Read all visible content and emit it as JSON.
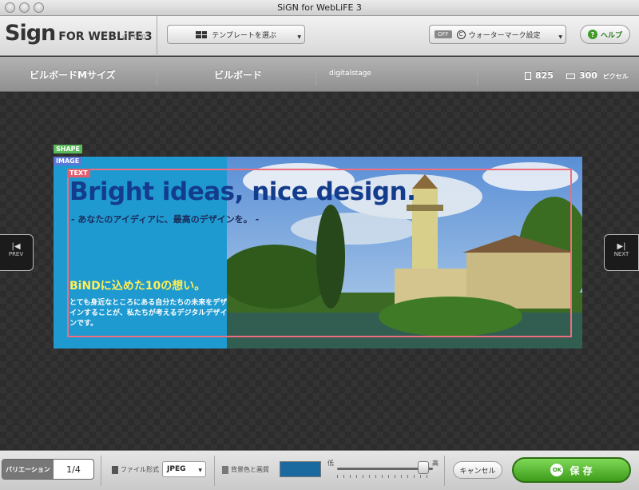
{
  "window": {
    "title": "SiGN for WebLiFE 3"
  },
  "toolbar": {
    "logo_sign": "Sign",
    "logo_rest": "FOR WEBLiFE",
    "logo_num": "3",
    "version": "v.3.000",
    "template_button": "テンプレートを選ぶ",
    "watermark_state": "OFF",
    "watermark_label": "ウォーターマーク設定",
    "help_label": "ヘルプ"
  },
  "info": {
    "size_name": "ビルボードMサイズ",
    "category": "ビルボード",
    "author": "digitalstage",
    "height": "825",
    "width": "300",
    "unit": "ピクセル"
  },
  "nav": {
    "prev": "PREV",
    "next": "NEXT"
  },
  "layers": {
    "shape": "SHAPE",
    "image": "IMAGE",
    "text": "TEXT"
  },
  "banner": {
    "headline": "Bright ideas, nice design.",
    "subline": "- あなたのアイディアに、最高のデザインを。 -",
    "bind_title": "BiNDに込めた10の想い。",
    "bind_body": "とても身近なところにある自分たちの未来をデザインすることが、私たちが考えるデジタルデザインです。"
  },
  "bottom": {
    "variation_label": "バリエーション",
    "variation_count": "1/4",
    "file_format_label": "ファイル形式",
    "file_format_value": "JPEG",
    "bg_quality_label": "背景色と画質",
    "quality_low": "低",
    "quality_high": "高",
    "quality_level": 0.9,
    "cancel_label": "キャンセル",
    "ok_badge": "OK",
    "save_label": "保 存"
  },
  "colors": {
    "banner_blue": "#1e9ad1",
    "headline": "#143c8c",
    "save_green": "#4fae2a",
    "bg_swatch": "#1a6aa0"
  }
}
